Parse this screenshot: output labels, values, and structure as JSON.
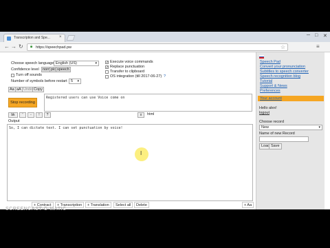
{
  "browser": {
    "tab_title": "Transcription and Spe...",
    "url": "https://speechpad.pw",
    "window_controls": [
      "─",
      "□",
      "✕"
    ]
  },
  "settings": {
    "language_label": "Choose speech language",
    "language_value": "English (US)",
    "confidence_label": "Confidence level",
    "confidence_chips": [
      "norm",
      "pic",
      "speech"
    ],
    "turn_off_sounds_label": "Turn off sounds",
    "symbols_label": "Number of symbols before restart",
    "symbols_value": "5",
    "execute_commands_label": "Execute voice commands",
    "replace_punct_label": "Replace punctuation",
    "transfer_clipboard_label": "Transfer to clipboard",
    "os_integration_label": "OS integration (till 2017-06-27)",
    "os_integration_badge": "?"
  },
  "toolbar": {
    "buttons": [
      "Aa",
      "aA",
      "Undo",
      "Copy"
    ],
    "stop_label": "Stop recording",
    "format_buttons": [
      "bk",
      "'",
      "-",
      "!",
      "?",
      "x"
    ],
    "html_label": "html"
  },
  "interim_text": "Registered users can use Voice come on",
  "output": {
    "label": "Output",
    "text": "So, I can dictate text. I can set punctuation by voice!"
  },
  "bottom_bar": {
    "buttons": [
      "+ Contract",
      "+ Transcription",
      "+ Translation",
      "Select all",
      "Delete"
    ],
    "right_button": "+ Aa"
  },
  "sidebar": {
    "links": [
      "Speech Pad",
      "Convert your pronunciation",
      "Subtitles to speech converter",
      "Speech recognition blog",
      "Tutorial",
      "Support & News",
      "Preferences"
    ],
    "active_link": "Your account",
    "hello": "Hello alex!",
    "username": "logout",
    "choose_record": "Choose record",
    "record_value": "New",
    "name_label": "Name of new Record",
    "load_button": "Load",
    "save_button": "Save"
  },
  "watermark": "SCREENCAST-O-MATIC",
  "colors": {
    "accent": "#f5a623",
    "link": "#1a5fb4"
  }
}
